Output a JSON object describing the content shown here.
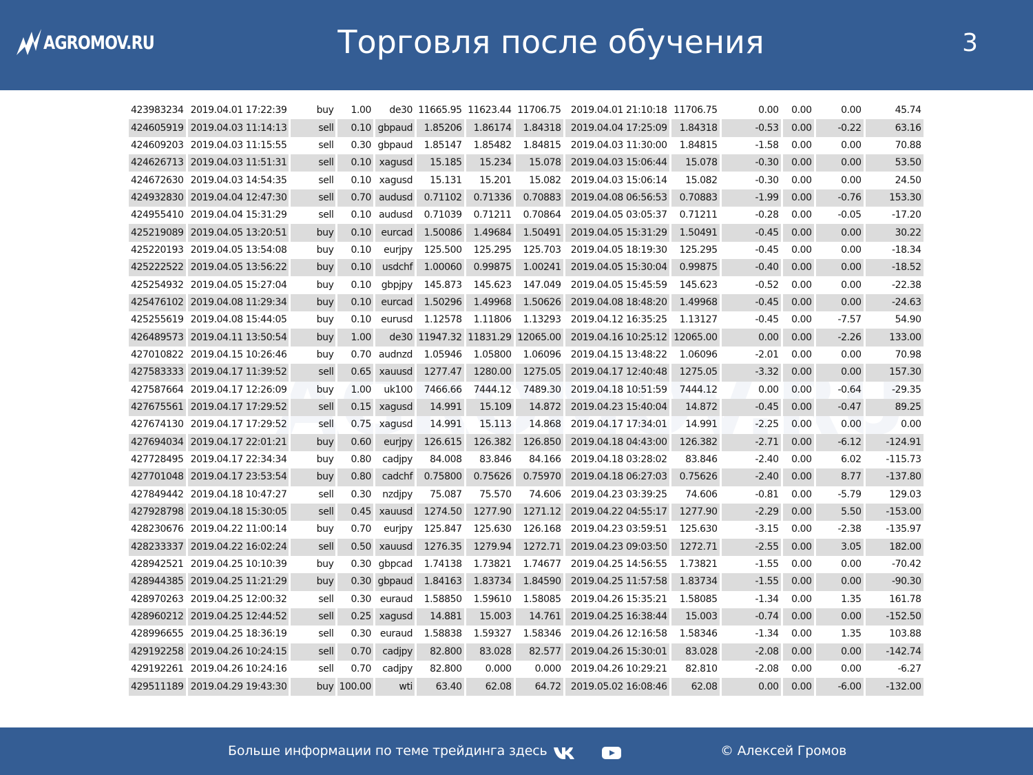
{
  "header": {
    "logo_text": "AGROMOV.RU",
    "title": "Торговля после обучения",
    "page_number": "3"
  },
  "watermark": "AGROMOV.RU",
  "trades": [
    [
      "423983234",
      "2019.04.01 17:22:39",
      "buy",
      "1.00",
      "de30",
      "11665.95",
      "11623.44",
      "11706.75",
      "2019.04.01 21:10:18",
      "11706.75",
      "0.00",
      "0.00",
      "0.00",
      "45.74"
    ],
    [
      "424605919",
      "2019.04.03 11:14:13",
      "sell",
      "0.10",
      "gbpaud",
      "1.85206",
      "1.86174",
      "1.84318",
      "2019.04.04 17:25:09",
      "1.84318",
      "-0.53",
      "0.00",
      "-0.22",
      "63.16"
    ],
    [
      "424609203",
      "2019.04.03 11:15:55",
      "sell",
      "0.30",
      "gbpaud",
      "1.85147",
      "1.85482",
      "1.84815",
      "2019.04.03 11:30:00",
      "1.84815",
      "-1.58",
      "0.00",
      "0.00",
      "70.88"
    ],
    [
      "424626713",
      "2019.04.03 11:51:31",
      "sell",
      "0.10",
      "xagusd",
      "15.185",
      "15.234",
      "15.078",
      "2019.04.03 15:06:44",
      "15.078",
      "-0.30",
      "0.00",
      "0.00",
      "53.50"
    ],
    [
      "424672630",
      "2019.04.03 14:54:35",
      "sell",
      "0.10",
      "xagusd",
      "15.131",
      "15.201",
      "15.082",
      "2019.04.03 15:06:14",
      "15.082",
      "-0.30",
      "0.00",
      "0.00",
      "24.50"
    ],
    [
      "424932830",
      "2019.04.04 12:47:30",
      "sell",
      "0.70",
      "audusd",
      "0.71102",
      "0.71336",
      "0.70883",
      "2019.04.08 06:56:53",
      "0.70883",
      "-1.99",
      "0.00",
      "-0.76",
      "153.30"
    ],
    [
      "424955410",
      "2019.04.04 15:31:29",
      "sell",
      "0.10",
      "audusd",
      "0.71039",
      "0.71211",
      "0.70864",
      "2019.04.05 03:05:37",
      "0.71211",
      "-0.28",
      "0.00",
      "-0.05",
      "-17.20"
    ],
    [
      "425219089",
      "2019.04.05 13:20:51",
      "buy",
      "0.10",
      "eurcad",
      "1.50086",
      "1.49684",
      "1.50491",
      "2019.04.05 15:31:29",
      "1.50491",
      "-0.45",
      "0.00",
      "0.00",
      "30.22"
    ],
    [
      "425220193",
      "2019.04.05 13:54:08",
      "buy",
      "0.10",
      "eurjpy",
      "125.500",
      "125.295",
      "125.703",
      "2019.04.05 18:19:30",
      "125.295",
      "-0.45",
      "0.00",
      "0.00",
      "-18.34"
    ],
    [
      "425222522",
      "2019.04.05 13:56:22",
      "buy",
      "0.10",
      "usdchf",
      "1.00060",
      "0.99875",
      "1.00241",
      "2019.04.05 15:30:04",
      "0.99875",
      "-0.40",
      "0.00",
      "0.00",
      "-18.52"
    ],
    [
      "425254932",
      "2019.04.05 15:27:04",
      "buy",
      "0.10",
      "gbpjpy",
      "145.873",
      "145.623",
      "147.049",
      "2019.04.05 15:45:59",
      "145.623",
      "-0.52",
      "0.00",
      "0.00",
      "-22.38"
    ],
    [
      "425476102",
      "2019.04.08 11:29:34",
      "buy",
      "0.10",
      "eurcad",
      "1.50296",
      "1.49968",
      "1.50626",
      "2019.04.08 18:48:20",
      "1.49968",
      "-0.45",
      "0.00",
      "0.00",
      "-24.63"
    ],
    [
      "425255619",
      "2019.04.08 15:44:05",
      "buy",
      "0.10",
      "eurusd",
      "1.12578",
      "1.11806",
      "1.13293",
      "2019.04.12 16:35:25",
      "1.13127",
      "-0.45",
      "0.00",
      "-7.57",
      "54.90"
    ],
    [
      "426489573",
      "2019.04.11 13:50:54",
      "buy",
      "1.00",
      "de30",
      "11947.32",
      "11831.29",
      "12065.00",
      "2019.04.16 10:25:12",
      "12065.00",
      "0.00",
      "0.00",
      "-2.26",
      "133.00"
    ],
    [
      "427010822",
      "2019.04.15 10:26:46",
      "buy",
      "0.70",
      "audnzd",
      "1.05946",
      "1.05800",
      "1.06096",
      "2019.04.15 13:48:22",
      "1.06096",
      "-2.01",
      "0.00",
      "0.00",
      "70.98"
    ],
    [
      "427583333",
      "2019.04.17 11:39:52",
      "sell",
      "0.65",
      "xauusd",
      "1277.47",
      "1280.00",
      "1275.05",
      "2019.04.17 12:40:48",
      "1275.05",
      "-3.32",
      "0.00",
      "0.00",
      "157.30"
    ],
    [
      "427587664",
      "2019.04.17 12:26:09",
      "buy",
      "1.00",
      "uk100",
      "7466.66",
      "7444.12",
      "7489.30",
      "2019.04.18 10:51:59",
      "7444.12",
      "0.00",
      "0.00",
      "-0.64",
      "-29.35"
    ],
    [
      "427675561",
      "2019.04.17 17:29:52",
      "sell",
      "0.15",
      "xagusd",
      "14.991",
      "15.109",
      "14.872",
      "2019.04.23 15:40:04",
      "14.872",
      "-0.45",
      "0.00",
      "-0.47",
      "89.25"
    ],
    [
      "427674130",
      "2019.04.17 17:29:52",
      "sell",
      "0.75",
      "xagusd",
      "14.991",
      "15.113",
      "14.868",
      "2019.04.17 17:34:01",
      "14.991",
      "-2.25",
      "0.00",
      "0.00",
      "0.00"
    ],
    [
      "427694034",
      "2019.04.17 22:01:21",
      "buy",
      "0.60",
      "eurjpy",
      "126.615",
      "126.382",
      "126.850",
      "2019.04.18 04:43:00",
      "126.382",
      "-2.71",
      "0.00",
      "-6.12",
      "-124.91"
    ],
    [
      "427728495",
      "2019.04.17 22:34:34",
      "buy",
      "0.80",
      "cadjpy",
      "84.008",
      "83.846",
      "84.166",
      "2019.04.18 03:28:02",
      "83.846",
      "-2.40",
      "0.00",
      "6.02",
      "-115.73"
    ],
    [
      "427701048",
      "2019.04.17 23:53:54",
      "buy",
      "0.80",
      "cadchf",
      "0.75800",
      "0.75626",
      "0.75970",
      "2019.04.18 06:27:03",
      "0.75626",
      "-2.40",
      "0.00",
      "8.77",
      "-137.80"
    ],
    [
      "427849442",
      "2019.04.18 10:47:27",
      "sell",
      "0.30",
      "nzdjpy",
      "75.087",
      "75.570",
      "74.606",
      "2019.04.23 03:39:25",
      "74.606",
      "-0.81",
      "0.00",
      "-5.79",
      "129.03"
    ],
    [
      "427928798",
      "2019.04.18 15:30:05",
      "sell",
      "0.45",
      "xauusd",
      "1274.50",
      "1277.90",
      "1271.12",
      "2019.04.22 04:55:17",
      "1277.90",
      "-2.29",
      "0.00",
      "5.50",
      "-153.00"
    ],
    [
      "428230676",
      "2019.04.22 11:00:14",
      "buy",
      "0.70",
      "eurjpy",
      "125.847",
      "125.630",
      "126.168",
      "2019.04.23 03:59:51",
      "125.630",
      "-3.15",
      "0.00",
      "-2.38",
      "-135.97"
    ],
    [
      "428233337",
      "2019.04.22 16:02:24",
      "sell",
      "0.50",
      "xauusd",
      "1276.35",
      "1279.94",
      "1272.71",
      "2019.04.23 09:03:50",
      "1272.71",
      "-2.55",
      "0.00",
      "3.05",
      "182.00"
    ],
    [
      "428942521",
      "2019.04.25 10:10:39",
      "buy",
      "0.30",
      "gbpcad",
      "1.74138",
      "1.73821",
      "1.74677",
      "2019.04.25 14:56:55",
      "1.73821",
      "-1.55",
      "0.00",
      "0.00",
      "-70.42"
    ],
    [
      "428944385",
      "2019.04.25 11:21:29",
      "buy",
      "0.30",
      "gbpaud",
      "1.84163",
      "1.83734",
      "1.84590",
      "2019.04.25 11:57:58",
      "1.83734",
      "-1.55",
      "0.00",
      "0.00",
      "-90.30"
    ],
    [
      "428970263",
      "2019.04.25 12:00:32",
      "sell",
      "0.30",
      "euraud",
      "1.58850",
      "1.59610",
      "1.58085",
      "2019.04.26 15:35:21",
      "1.58085",
      "-1.34",
      "0.00",
      "1.35",
      "161.78"
    ],
    [
      "428960212",
      "2019.04.25 12:44:52",
      "sell",
      "0.25",
      "xagusd",
      "14.881",
      "15.003",
      "14.761",
      "2019.04.25 16:38:44",
      "15.003",
      "-0.74",
      "0.00",
      "0.00",
      "-152.50"
    ],
    [
      "428996655",
      "2019.04.25 18:36:19",
      "sell",
      "0.30",
      "euraud",
      "1.58838",
      "1.59327",
      "1.58346",
      "2019.04.26 12:16:58",
      "1.58346",
      "-1.34",
      "0.00",
      "1.35",
      "103.88"
    ],
    [
      "429192258",
      "2019.04.26 10:24:15",
      "sell",
      "0.70",
      "cadjpy",
      "82.800",
      "83.028",
      "82.577",
      "2019.04.26 15:30:01",
      "83.028",
      "-2.08",
      "0.00",
      "0.00",
      "-142.74"
    ],
    [
      "429192261",
      "2019.04.26 10:24:16",
      "sell",
      "0.70",
      "cadjpy",
      "82.800",
      "0.000",
      "0.000",
      "2019.04.26 10:29:21",
      "82.810",
      "-2.08",
      "0.00",
      "0.00",
      "-6.27"
    ],
    [
      "429511189",
      "2019.04.29 19:43:30",
      "buy",
      "100.00",
      "wti",
      "63.40",
      "62.08",
      "64.72",
      "2019.05.02 16:08:46",
      "62.08",
      "0.00",
      "0.00",
      "-6.00",
      "-132.00"
    ]
  ],
  "footer": {
    "info_text": "Больше информации по теме трейдинга здесь",
    "vk_icon": "vk-icon",
    "youtube_icon": "youtube-icon",
    "copyright": "© Алексей Громов"
  }
}
